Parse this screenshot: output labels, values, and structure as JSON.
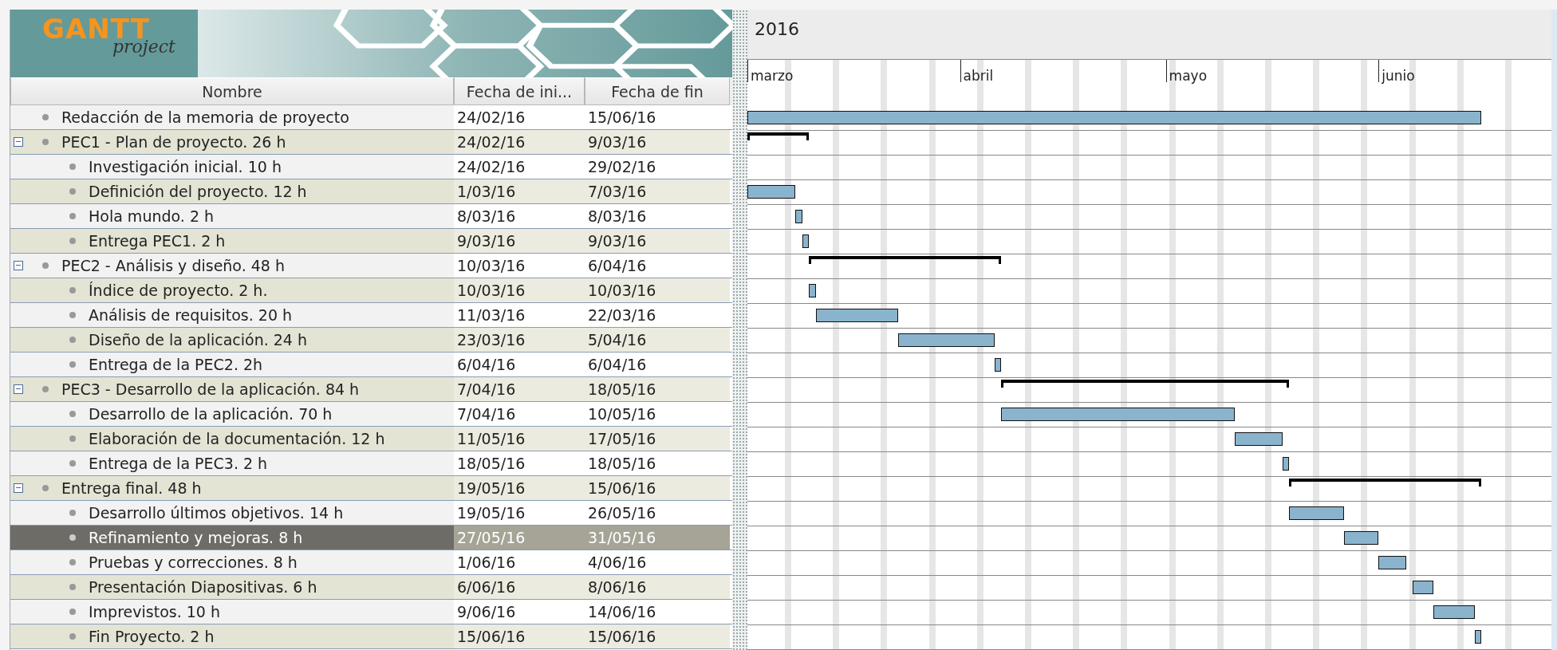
{
  "logo": {
    "title": "GANTT",
    "subtitle": "project"
  },
  "columns": [
    {
      "label": "Nombre"
    },
    {
      "label": "Fecha de ini..."
    },
    {
      "label": "Fecha de fin"
    }
  ],
  "timeline": {
    "year": "2016",
    "months": [
      {
        "label": "marzo"
      },
      {
        "label": "abril"
      },
      {
        "label": "mayo"
      },
      {
        "label": "junio"
      }
    ]
  },
  "tasks": [
    {
      "kind": "task",
      "name": "Redacción de la memoria de proyecto",
      "start": "24/02/16",
      "end": "15/06/16",
      "selected": false
    },
    {
      "kind": "summary",
      "name": "PEC1 - Plan de proyecto. 26 h",
      "start": "24/02/16",
      "end": "9/03/16",
      "selected": false,
      "expanded": true,
      "children": [
        {
          "kind": "task",
          "name": "Investigación inicial. 10 h",
          "start": "24/02/16",
          "end": "29/02/16",
          "selected": false
        },
        {
          "kind": "task",
          "name": "Definición del proyecto. 12 h",
          "start": "1/03/16",
          "end": "7/03/16",
          "selected": false
        },
        {
          "kind": "task",
          "name": "Hola mundo. 2 h",
          "start": "8/03/16",
          "end": "8/03/16",
          "selected": false
        },
        {
          "kind": "task",
          "name": "Entrega PEC1. 2 h",
          "start": "9/03/16",
          "end": "9/03/16",
          "selected": false
        }
      ]
    },
    {
      "kind": "summary",
      "name": "PEC2 - Análisis y diseño. 48 h",
      "start": "10/03/16",
      "end": "6/04/16",
      "selected": false,
      "expanded": true,
      "children": [
        {
          "kind": "task",
          "name": "Índice de proyecto. 2 h.",
          "start": "10/03/16",
          "end": "10/03/16",
          "selected": false
        },
        {
          "kind": "task",
          "name": "Análisis de requisitos. 20 h",
          "start": "11/03/16",
          "end": "22/03/16",
          "selected": false
        },
        {
          "kind": "task",
          "name": "Diseño de la aplicación. 24 h",
          "start": "23/03/16",
          "end": "5/04/16",
          "selected": false
        },
        {
          "kind": "task",
          "name": "Entrega de la PEC2. 2h",
          "start": "6/04/16",
          "end": "6/04/16",
          "selected": false
        }
      ]
    },
    {
      "kind": "summary",
      "name": "PEC3 - Desarrollo de la aplicación. 84 h",
      "start": "7/04/16",
      "end": "18/05/16",
      "selected": false,
      "expanded": true,
      "children": [
        {
          "kind": "task",
          "name": "Desarrollo de la aplicación. 70 h",
          "start": "7/04/16",
          "end": "10/05/16",
          "selected": false
        },
        {
          "kind": "task",
          "name": "Elaboración de la documentación. 12 h",
          "start": "11/05/16",
          "end": "17/05/16",
          "selected": false
        },
        {
          "kind": "task",
          "name": "Entrega de la PEC3. 2 h",
          "start": "18/05/16",
          "end": "18/05/16",
          "selected": false
        }
      ]
    },
    {
      "kind": "summary",
      "name": "Entrega final. 48 h",
      "start": "19/05/16",
      "end": "15/06/16",
      "selected": false,
      "expanded": true,
      "children": [
        {
          "kind": "task",
          "name": "Desarrollo últimos objetivos. 14 h",
          "start": "19/05/16",
          "end": "26/05/16",
          "selected": false
        },
        {
          "kind": "task",
          "name": "Refinamiento y mejoras. 8 h",
          "start": "27/05/16",
          "end": "31/05/16",
          "selected": true
        },
        {
          "kind": "task",
          "name": "Pruebas y correcciones. 8 h",
          "start": "1/06/16",
          "end": "4/06/16",
          "selected": false
        },
        {
          "kind": "task",
          "name": "Presentación Diapositivas. 6 h",
          "start": "6/06/16",
          "end": "8/06/16",
          "selected": false
        },
        {
          "kind": "task",
          "name": "Imprevistos. 10 h",
          "start": "9/06/16",
          "end": "14/06/16",
          "selected": false
        },
        {
          "kind": "task",
          "name": "Fin Proyecto. 2 h",
          "start": "15/06/16",
          "end": "15/06/16",
          "selected": false
        }
      ]
    }
  ]
}
